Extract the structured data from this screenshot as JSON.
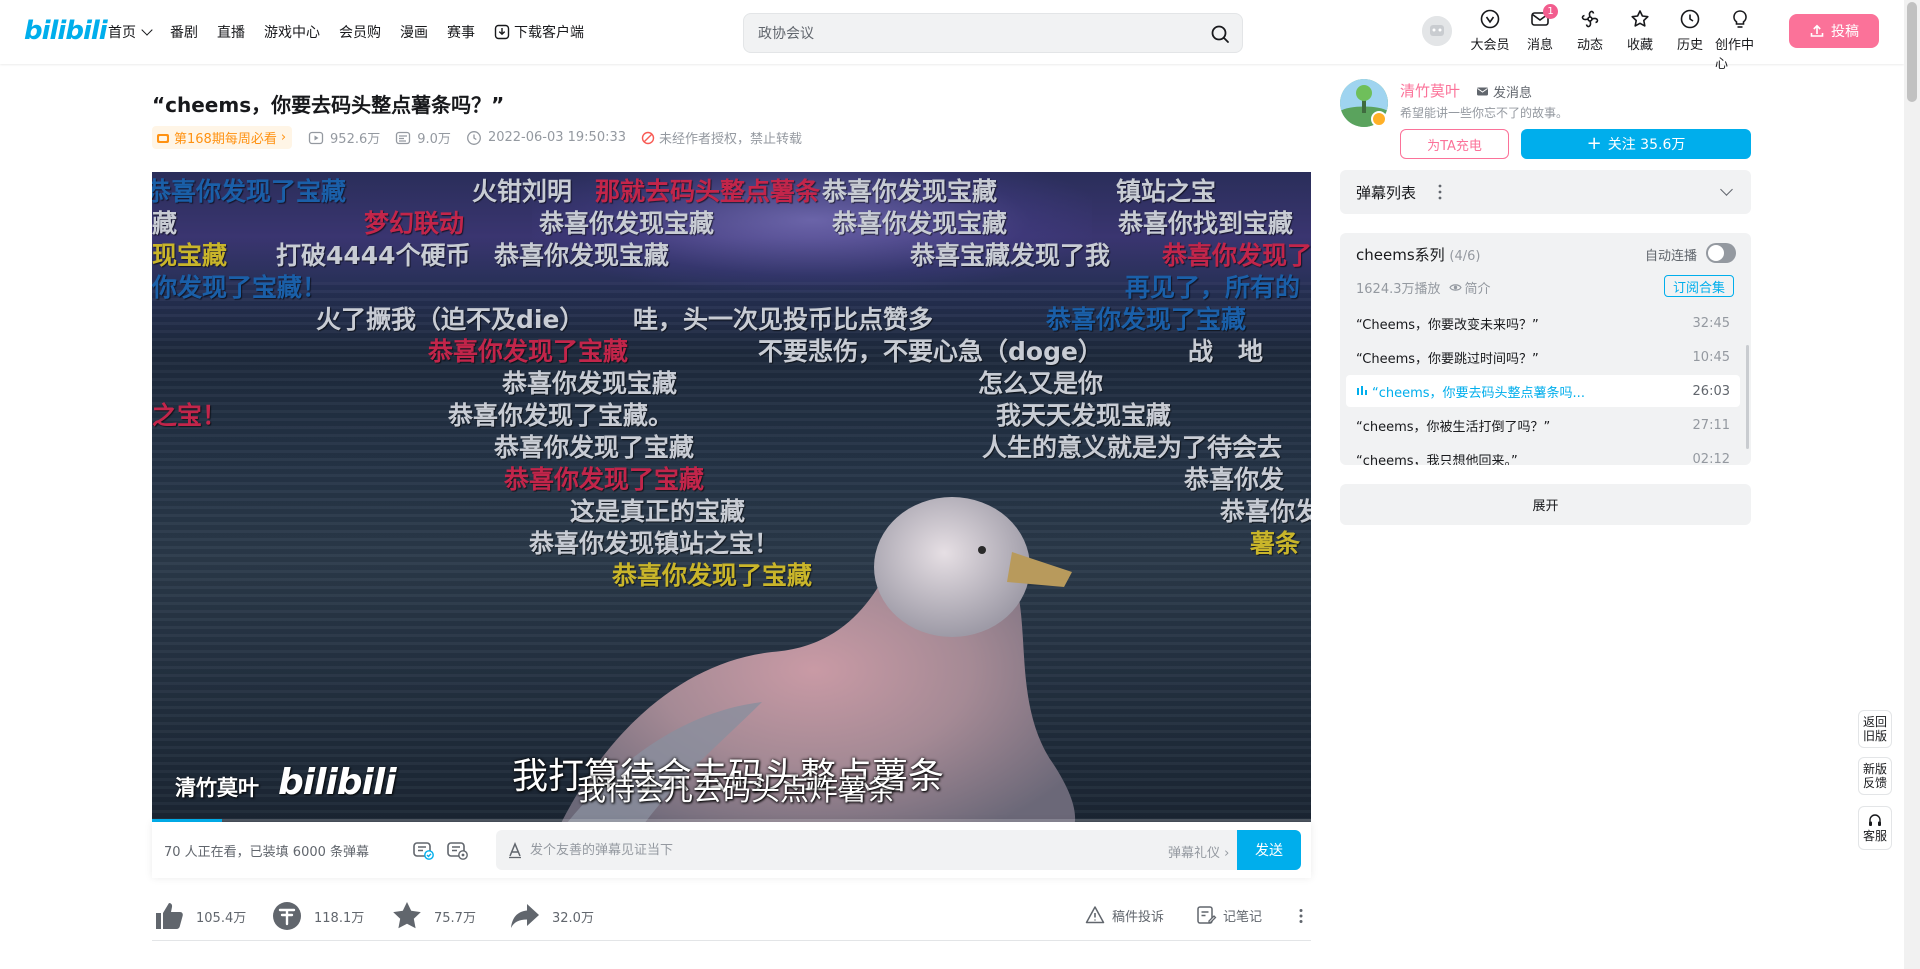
{
  "header": {
    "logo": "bilibili",
    "nav": [
      "首页",
      "番剧",
      "直播",
      "游戏中心",
      "会员购",
      "漫画",
      "赛事",
      "下载客户端"
    ],
    "search_placeholder": "政协会议",
    "entries": [
      {
        "label": "大会员",
        "icon": "vip-icon"
      },
      {
        "label": "消息",
        "icon": "message-icon",
        "badge": "1"
      },
      {
        "label": "动态",
        "icon": "dynamic-icon"
      },
      {
        "label": "收藏",
        "icon": "star-icon"
      },
      {
        "label": "历史",
        "icon": "clock-icon"
      },
      {
        "label": "创作中心",
        "icon": "bulb-icon"
      }
    ],
    "upload_label": "投稿"
  },
  "video": {
    "title": "“cheems，你要去码头整点薯条吗？”",
    "weekly_badge": "第168期每周必看",
    "views": "952.6万",
    "danmaku_count": "9.0万",
    "date": "2022-06-03 19:50:33",
    "copyright": "未经作者授权，禁止转载"
  },
  "player": {
    "subtitle_main": "我打算待会去码头整点薯条",
    "subtitle_overlay": "我待会儿去码头点炸薯条",
    "watermark_name": "清竹莫叶",
    "watermark_logo": "bilibili",
    "danmaku": [
      {
        "text": "恭喜你发现了宝藏",
        "color": "#1a5fa8"
      },
      {
        "text": "火钳刘明",
        "color": "#c8ccd4"
      },
      {
        "text": "那就去码头整点薯条",
        "color": "#c2254a"
      },
      {
        "text": "恭喜你发现宝藏",
        "color": "#c8ccd4"
      },
      {
        "text": "镇站之宝",
        "color": "#c8ccd4"
      },
      {
        "text": "藏",
        "color": "#c8ccd4"
      },
      {
        "text": "梦幻联动",
        "color": "#c2254a"
      },
      {
        "text": "恭喜你发现宝藏",
        "color": "#c8ccd4"
      },
      {
        "text": "恭喜你发现宝藏",
        "color": "#c8ccd4"
      },
      {
        "text": "恭喜你找到宝藏",
        "color": "#c8ccd4"
      },
      {
        "text": "现宝藏",
        "color": "#c9b52a"
      },
      {
        "text": "打破4444个硬币",
        "color": "#c8ccd4"
      },
      {
        "text": "恭喜你发现宝藏",
        "color": "#c8ccd4"
      },
      {
        "text": "恭喜宝藏发现了我",
        "color": "#c8ccd4"
      },
      {
        "text": "恭喜你发现了",
        "color": "#c2254a"
      },
      {
        "text": "你发现了宝藏！",
        "color": "#1a5fa8"
      },
      {
        "text": "再见了，所有的",
        "color": "#1a5fa8"
      },
      {
        "text": "火了撅我（迫不及die）",
        "color": "#c8ccd4"
      },
      {
        "text": "哇，头一次见投币比点赞多",
        "color": "#c8ccd4"
      },
      {
        "text": "恭喜你发现了宝藏",
        "color": "#1a5fa8"
      },
      {
        "text": "恭喜你发现了宝藏",
        "color": "#c2254a"
      },
      {
        "text": "不要悲伤，不要心急（doge）",
        "color": "#c8ccd4"
      },
      {
        "text": "战　地",
        "color": "#c8ccd4"
      },
      {
        "text": "恭喜你发现宝藏",
        "color": "#c8ccd4"
      },
      {
        "text": "怎么又是你",
        "color": "#c8ccd4"
      },
      {
        "text": "之宝！",
        "color": "#c2254a"
      },
      {
        "text": "恭喜你发现了宝藏。",
        "color": "#c8ccd4"
      },
      {
        "text": "我天天发现宝藏",
        "color": "#c8ccd4"
      },
      {
        "text": "恭喜你发现了宝藏",
        "color": "#c8ccd4"
      },
      {
        "text": "人生的意义就是为了待会去",
        "color": "#c8ccd4"
      },
      {
        "text": "恭喜你发现了宝藏",
        "color": "#c2254a"
      },
      {
        "text": "恭喜你发",
        "color": "#c8ccd4"
      },
      {
        "text": "这是真正的宝藏",
        "color": "#c8ccd4"
      },
      {
        "text": "恭喜你发",
        "color": "#c8ccd4"
      },
      {
        "text": "恭喜你发现镇站之宝！",
        "color": "#c8ccd4"
      },
      {
        "text": "薯条",
        "color": "#c9b52a"
      },
      {
        "text": "恭喜你发现了宝藏",
        "color": "#c9b52a"
      }
    ]
  },
  "danmaku_bar": {
    "watching": "70 人正在看，已装填 6000 条弹幕",
    "input_placeholder": "发个友善的弹幕见证当下",
    "etiquette": "弹幕礼仪",
    "send": "发送"
  },
  "actions": {
    "like": "105.4万",
    "coin": "118.1万",
    "favorite": "75.7万",
    "share": "32.0万",
    "report": "稿件投诉",
    "note": "记笔记"
  },
  "uploader": {
    "name": "清竹莫叶",
    "message": "发消息",
    "desc": "希望能讲一些你忘不了的故事。",
    "charge": "为TA充电",
    "follow": "关注 35.6万"
  },
  "danmaku_list": {
    "label": "弹幕列表"
  },
  "series": {
    "title": "cheems系列",
    "count": "(4/6)",
    "autoplay": "自动连播",
    "plays": "1624.3万播放",
    "intro": "简介",
    "subscribe": "订阅合集",
    "episodes": [
      {
        "title": "“Cheems，你要改变未来吗？”",
        "duration": "32:45",
        "active": false
      },
      {
        "title": "“Cheems，你要跳过时间吗？”",
        "duration": "10:45",
        "active": false
      },
      {
        "title": "“cheems，你要去码头整点薯条吗...",
        "duration": "26:03",
        "active": true
      },
      {
        "title": "“cheems，你被生活打倒了吗？”",
        "duration": "27:11",
        "active": false
      },
      {
        "title": "“cheems，我只想他回来。”",
        "duration": "02:12",
        "active": false
      }
    ],
    "expand": "展开"
  },
  "floating": [
    "返回旧版",
    "新版反馈",
    "客服"
  ],
  "colors": {
    "accent": "#00aeec",
    "pink": "#fb7299",
    "muted": "#9499a0"
  }
}
